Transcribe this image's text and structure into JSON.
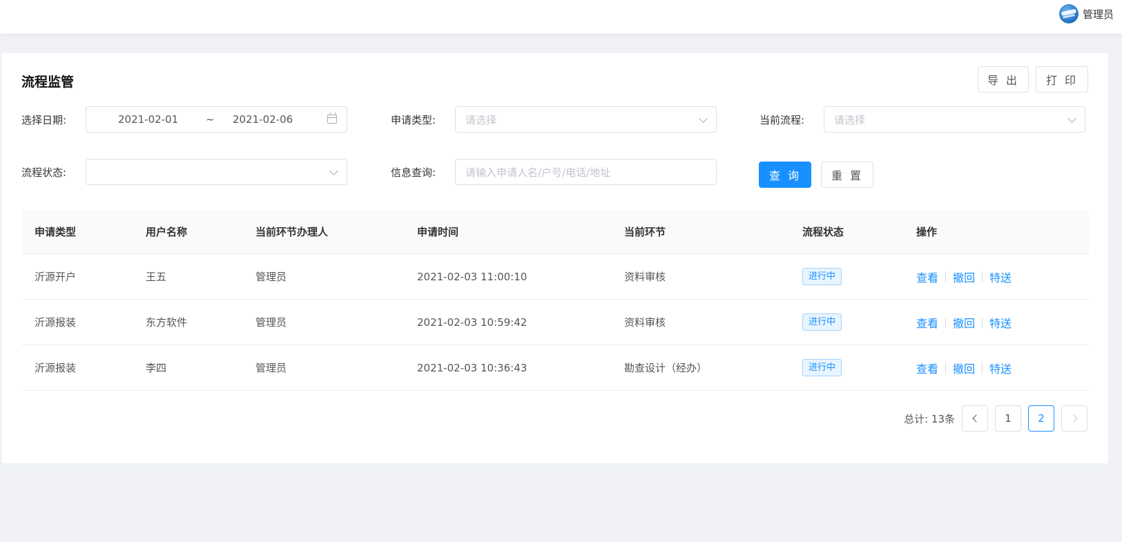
{
  "header": {
    "user_name": "管理员"
  },
  "page": {
    "title": "流程监管",
    "export_label": "导 出",
    "print_label": "打 印"
  },
  "filters": {
    "date_label": "选择日期:",
    "date_start": "2021-02-01",
    "date_sep": "~",
    "date_end": "2021-02-06",
    "apply_type_label": "申请类型:",
    "apply_type_placeholder": "请选择",
    "current_flow_label": "当前流程:",
    "current_flow_placeholder": "请选择",
    "flow_status_label": "流程状态:",
    "flow_status_value": "",
    "info_query_label": "信息查询:",
    "info_query_placeholder": "请输入申请人名/户号/电话/地址",
    "search_label": "查 询",
    "reset_label": "重 置"
  },
  "table": {
    "columns": [
      "申请类型",
      "用户名称",
      "当前环节办理人",
      "申请时间",
      "当前环节",
      "流程状态",
      "操作"
    ],
    "rows": [
      {
        "type": "沂源开户",
        "user": "王五",
        "handler": "管理员",
        "time": "2021-02-03 11:00:10",
        "step": "资料审核",
        "status": "进行中"
      },
      {
        "type": "沂源报装",
        "user": "东方软件",
        "handler": "管理员",
        "time": "2021-02-03 10:59:42",
        "step": "资料审核",
        "status": "进行中"
      },
      {
        "type": "沂源报装",
        "user": "李四",
        "handler": "管理员",
        "time": "2021-02-03 10:36:43",
        "step": "勘查设计（经办）",
        "status": "进行中"
      }
    ],
    "actions": {
      "view": "查看",
      "revoke": "撤回",
      "forward": "特送"
    }
  },
  "pagination": {
    "total": "总计: 13条",
    "pages": [
      "1",
      "2"
    ],
    "current": "2"
  },
  "colors": {
    "primary": "#1890ff",
    "tag_bg": "#e8f4ff"
  }
}
